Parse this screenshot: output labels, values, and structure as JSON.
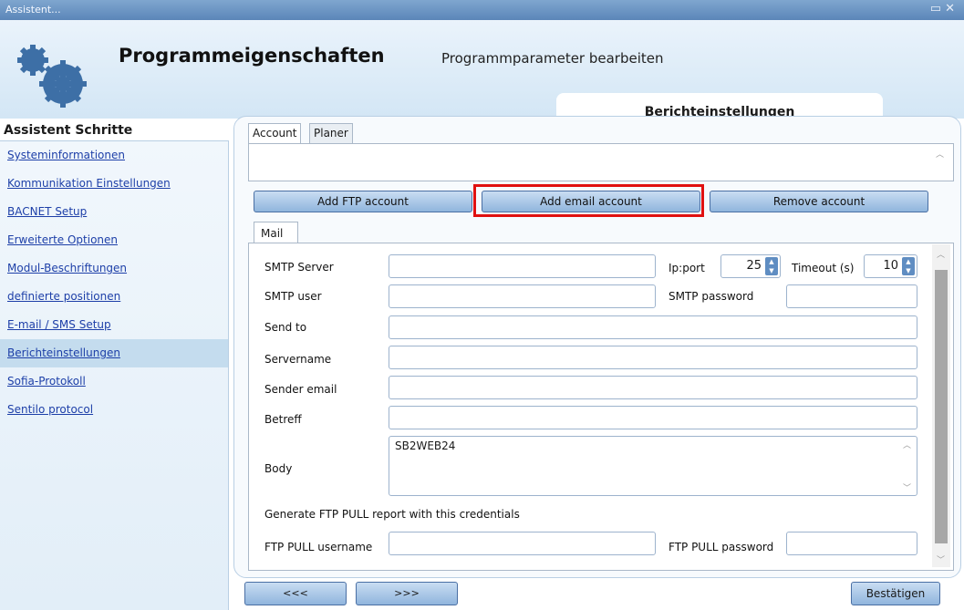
{
  "window": {
    "title": "Assistent..."
  },
  "header": {
    "title": "Programmeigenschaften",
    "subtitle": "Programmparameter bearbeiten",
    "section_tab": "Berichteinstellungen"
  },
  "sidebar": {
    "title": "Assistent Schritte",
    "items": [
      {
        "label": "Systeminformationen"
      },
      {
        "label": "Kommunikation Einstellungen"
      },
      {
        "label": "BACNET Setup"
      },
      {
        "label": "Erweiterte Optionen"
      },
      {
        "label": "Modul-Beschriftungen"
      },
      {
        "label": "definierte positionen"
      },
      {
        "label": "E-mail / SMS Setup"
      },
      {
        "label": "Berichteinstellungen"
      },
      {
        "label": "Sofia-Protokoll"
      },
      {
        "label": "Sentilo protocol"
      }
    ],
    "active_index": 7
  },
  "tabs": {
    "account": "Account",
    "planer": "Planer",
    "mail": "Mail"
  },
  "buttons": {
    "add_ftp": "Add FTP account",
    "add_email": "Add email account",
    "remove": "Remove account",
    "prev": "<<<",
    "next": ">>>",
    "confirm": "Bestätigen"
  },
  "mail": {
    "smtp_server_label": "SMTP Server",
    "smtp_server_value": "",
    "ipport_label": "Ip:port",
    "ipport_value": "25",
    "timeout_label": "Timeout (s)",
    "timeout_value": "10",
    "smtp_user_label": "SMTP user",
    "smtp_user_value": "",
    "smtp_password_label": "SMTP password",
    "smtp_password_value": "",
    "send_to_label": "Send to",
    "send_to_value": "",
    "servername_label": "Servername",
    "servername_value": "",
    "sender_email_label": "Sender email",
    "sender_email_value": "",
    "subject_label": "Betreff",
    "subject_value": "",
    "body_label": "Body",
    "body_value": "SB2WEB24",
    "ftp_pull_note": "Generate FTP PULL report with this credentials",
    "ftp_pull_username_label": "FTP PULL username",
    "ftp_pull_username_value": "",
    "ftp_pull_password_label": "FTP PULL password",
    "ftp_pull_password_value": ""
  },
  "colors": {
    "highlight": "#e01010",
    "accent": "#5f8dc2",
    "link": "#1d3fa8"
  }
}
